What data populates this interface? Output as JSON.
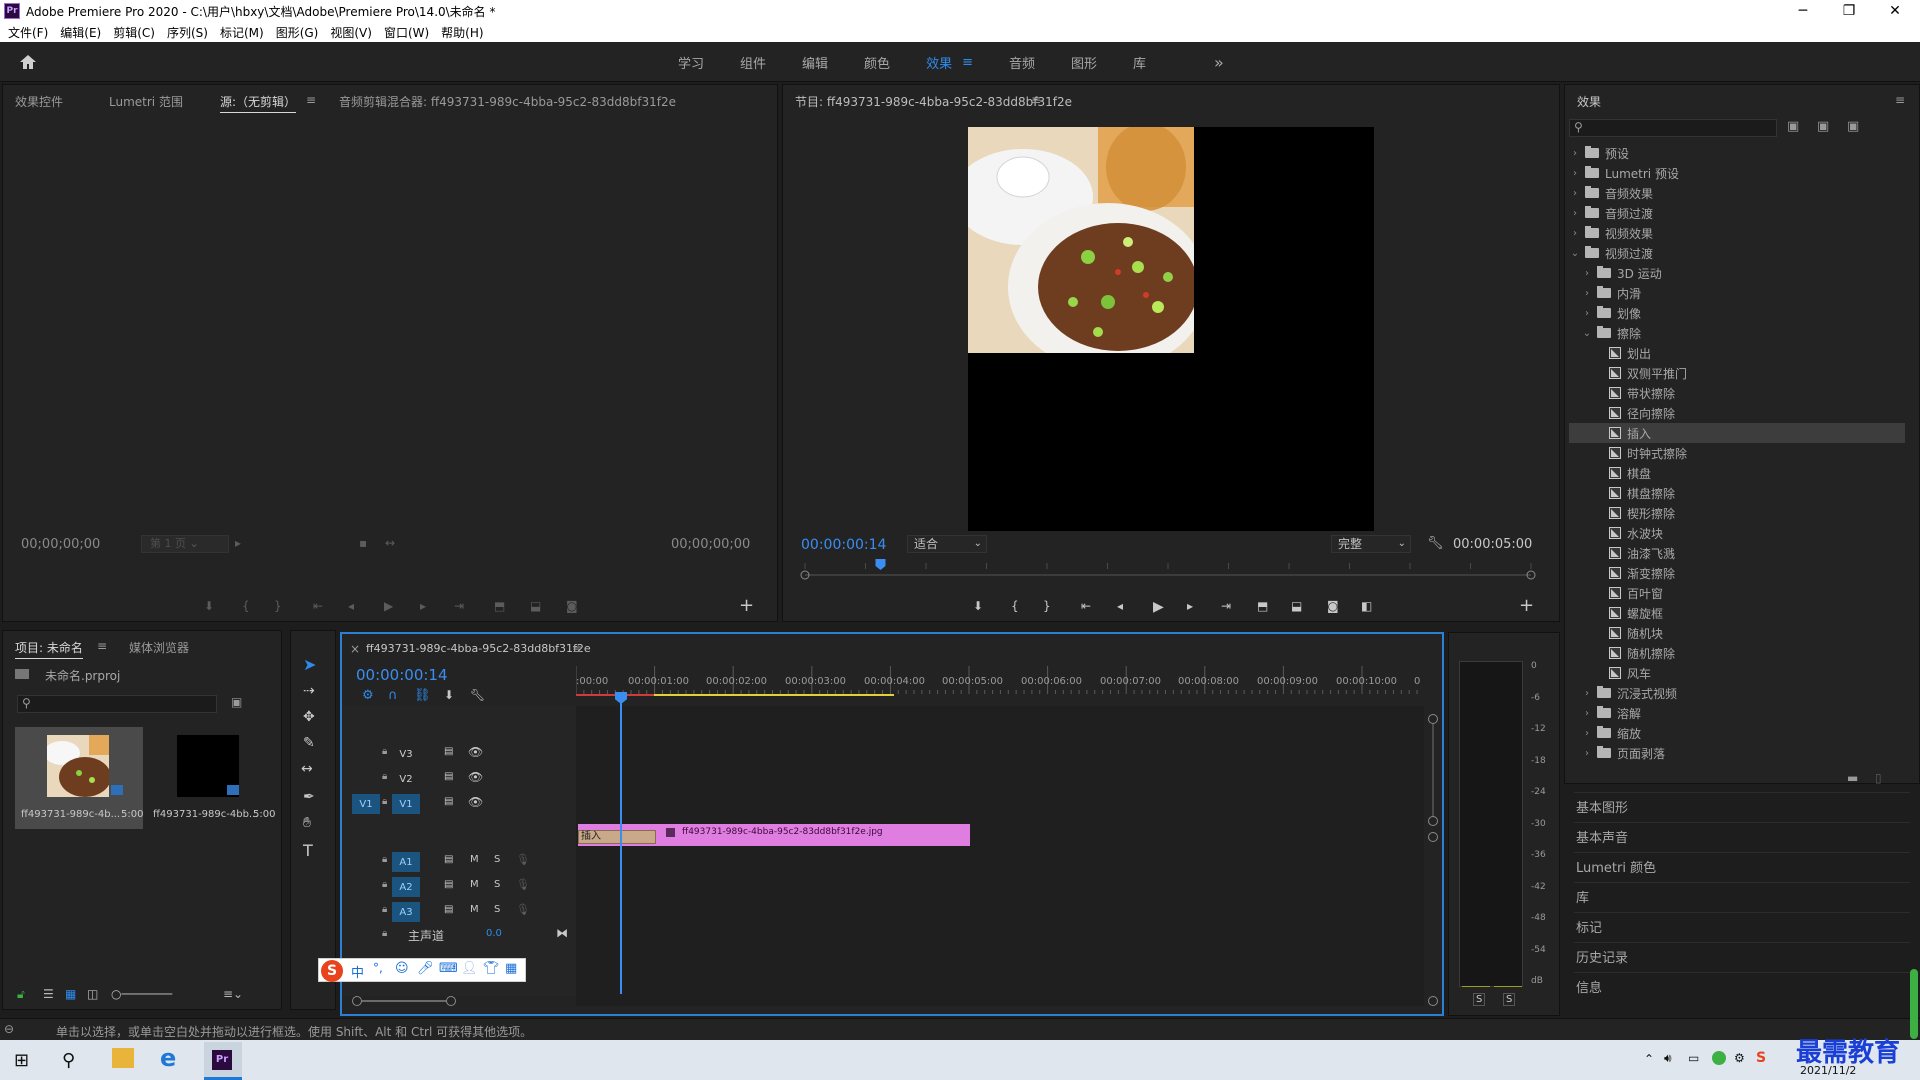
{
  "window": {
    "title": "Adobe Premiere Pro 2020 - C:\\用户\\hbxy\\文档\\Adobe\\Premiere Pro\\14.0\\未命名 *",
    "logo_text": "Pr",
    "min": "─",
    "max": "❐",
    "close": "✕"
  },
  "menu": [
    "文件(F)",
    "编辑(E)",
    "剪辑(C)",
    "序列(S)",
    "标记(M)",
    "图形(G)",
    "视图(V)",
    "窗口(W)",
    "帮助(H)"
  ],
  "workspaces": {
    "items": [
      "学习",
      "组件",
      "编辑",
      "颜色",
      "效果",
      "音频",
      "图形",
      "库"
    ],
    "active_index": 4,
    "active_menu": "≡",
    "more": "»"
  },
  "source_panel": {
    "tabs": [
      "效果控件",
      "Lumetri 范围",
      "源:（无剪辑）",
      "音频剪辑混合器: ff493731-989c-4bba-95c2-83dd8bf31f2e"
    ],
    "active_index": 2,
    "tab_menu": "≡",
    "timecode_left": "00;00;00;00",
    "page_select": "第 1 页",
    "timecode_right": "00;00;00;00",
    "add": "+"
  },
  "program_monitor": {
    "title": "节目: ff493731-989c-4bba-95c2-83dd8bf31f2e",
    "title_menu": "≡",
    "timecode": "00:00:00:14",
    "fit": "适合",
    "quality": "完整",
    "duration": "00:00:05:00",
    "playhead_fraction": 0.104,
    "add": "+"
  },
  "effects_panel": {
    "title": "效果",
    "menu": "≡",
    "search_placeholder": "",
    "tree": [
      {
        "label": "预设",
        "level": 0,
        "type": "folder",
        "expanded": false
      },
      {
        "label": "Lumetri 预设",
        "level": 0,
        "type": "folder",
        "expanded": false
      },
      {
        "label": "音频效果",
        "level": 0,
        "type": "folder",
        "expanded": false
      },
      {
        "label": "音频过渡",
        "level": 0,
        "type": "folder",
        "expanded": false
      },
      {
        "label": "视频效果",
        "level": 0,
        "type": "folder",
        "expanded": false
      },
      {
        "label": "视频过渡",
        "level": 0,
        "type": "folder",
        "expanded": true
      },
      {
        "label": "3D 运动",
        "level": 1,
        "type": "folder",
        "expanded": false
      },
      {
        "label": "内滑",
        "level": 1,
        "type": "folder",
        "expanded": false
      },
      {
        "label": "划像",
        "level": 1,
        "type": "folder",
        "expanded": false
      },
      {
        "label": "擦除",
        "level": 1,
        "type": "folder",
        "expanded": true
      },
      {
        "label": "划出",
        "level": 2,
        "type": "fx"
      },
      {
        "label": "双侧平推门",
        "level": 2,
        "type": "fx"
      },
      {
        "label": "带状擦除",
        "level": 2,
        "type": "fx"
      },
      {
        "label": "径向擦除",
        "level": 2,
        "type": "fx"
      },
      {
        "label": "插入",
        "level": 2,
        "type": "fx",
        "selected": true
      },
      {
        "label": "时钟式擦除",
        "level": 2,
        "type": "fx"
      },
      {
        "label": "棋盘",
        "level": 2,
        "type": "fx"
      },
      {
        "label": "棋盘擦除",
        "level": 2,
        "type": "fx"
      },
      {
        "label": "楔形擦除",
        "level": 2,
        "type": "fx"
      },
      {
        "label": "水波块",
        "level": 2,
        "type": "fx"
      },
      {
        "label": "油漆飞溅",
        "level": 2,
        "type": "fx"
      },
      {
        "label": "渐变擦除",
        "level": 2,
        "type": "fx"
      },
      {
        "label": "百叶窗",
        "level": 2,
        "type": "fx"
      },
      {
        "label": "螺旋框",
        "level": 2,
        "type": "fx"
      },
      {
        "label": "随机块",
        "level": 2,
        "type": "fx"
      },
      {
        "label": "随机擦除",
        "level": 2,
        "type": "fx"
      },
      {
        "label": "风车",
        "level": 2,
        "type": "fx"
      },
      {
        "label": "沉浸式视频",
        "level": 1,
        "type": "folder",
        "expanded": false
      },
      {
        "label": "溶解",
        "level": 1,
        "type": "folder",
        "expanded": false
      },
      {
        "label": "缩放",
        "level": 1,
        "type": "folder",
        "expanded": false
      },
      {
        "label": "页面剥落",
        "level": 1,
        "type": "folder",
        "expanded": false
      }
    ],
    "collapsed_panels": [
      "基本图形",
      "基本声音",
      "Lumetri 颜色",
      "库",
      "标记",
      "历史记录",
      "信息"
    ]
  },
  "project_panel": {
    "tabs": [
      "项目: 未命名",
      "媒体浏览器"
    ],
    "tab_menu": "≡",
    "project_file": "未命名.prproj",
    "items": [
      {
        "name": "ff493731-989c-4b...",
        "duration": "5:00"
      },
      {
        "name": "ff493731-989c-4bb...",
        "duration": "5:00"
      }
    ]
  },
  "timeline": {
    "sequence_tab": "ff493731-989c-4bba-95c2-83dd8bf31f2e",
    "close": "×",
    "tab_menu": "≡",
    "timecode": "00:00:00:14",
    "ruler": [
      ":00:00",
      "00:00:01:00",
      "00:00:02:00",
      "00:00:03:00",
      "00:00:04:00",
      "00:00:05:00",
      "00:00:06:00",
      "00:00:07:00",
      "00:00:08:00",
      "00:00:09:00",
      "00:00:10:00",
      "0"
    ],
    "video_tracks": [
      "V3",
      "V2",
      "V1"
    ],
    "source_patch": "V1",
    "audio_tracks": [
      "A1",
      "A2",
      "A3"
    ],
    "mute": "M",
    "solo": "S",
    "master": "主声道",
    "master_value": "0.0",
    "transition_label": "插入",
    "clip_name": "ff493731-989c-4bba-95c2-83dd8bf31f2e.jpg"
  },
  "audio_meter": {
    "ticks": [
      "0",
      "-6",
      "-12",
      "-18",
      "-24",
      "-30",
      "-36",
      "-42",
      "-48",
      "-54",
      "dB"
    ],
    "solo_left": "S",
    "solo_right": "S"
  },
  "ime_bar": {
    "label": "中"
  },
  "status_bar": "单击以选择，或单击空白处并拖动以进行框选。使用 Shift、Alt 和 Ctrl 可获得其他选项。",
  "taskbar": {
    "watermark": "最需教育",
    "date": "2021/11/2"
  },
  "colors": {
    "accent": "#2d8ceb",
    "clip": "#e07de0",
    "transition": "#c9a98a",
    "playhead": "#3a8ef2"
  }
}
